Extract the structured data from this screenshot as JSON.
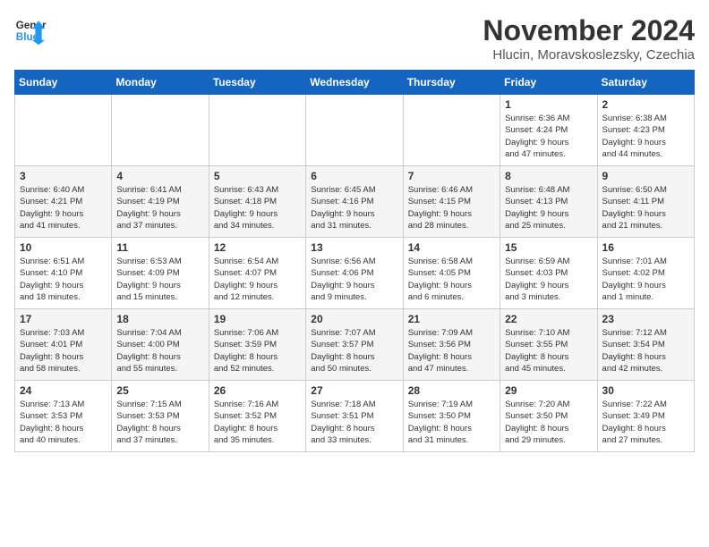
{
  "header": {
    "logo_line1": "General",
    "logo_line2": "Blue",
    "month": "November 2024",
    "location": "Hlucin, Moravskoslezsky, Czechia"
  },
  "weekdays": [
    "Sunday",
    "Monday",
    "Tuesday",
    "Wednesday",
    "Thursday",
    "Friday",
    "Saturday"
  ],
  "weeks": [
    [
      {
        "day": "",
        "info": ""
      },
      {
        "day": "",
        "info": ""
      },
      {
        "day": "",
        "info": ""
      },
      {
        "day": "",
        "info": ""
      },
      {
        "day": "",
        "info": ""
      },
      {
        "day": "1",
        "info": "Sunrise: 6:36 AM\nSunset: 4:24 PM\nDaylight: 9 hours\nand 47 minutes."
      },
      {
        "day": "2",
        "info": "Sunrise: 6:38 AM\nSunset: 4:23 PM\nDaylight: 9 hours\nand 44 minutes."
      }
    ],
    [
      {
        "day": "3",
        "info": "Sunrise: 6:40 AM\nSunset: 4:21 PM\nDaylight: 9 hours\nand 41 minutes."
      },
      {
        "day": "4",
        "info": "Sunrise: 6:41 AM\nSunset: 4:19 PM\nDaylight: 9 hours\nand 37 minutes."
      },
      {
        "day": "5",
        "info": "Sunrise: 6:43 AM\nSunset: 4:18 PM\nDaylight: 9 hours\nand 34 minutes."
      },
      {
        "day": "6",
        "info": "Sunrise: 6:45 AM\nSunset: 4:16 PM\nDaylight: 9 hours\nand 31 minutes."
      },
      {
        "day": "7",
        "info": "Sunrise: 6:46 AM\nSunset: 4:15 PM\nDaylight: 9 hours\nand 28 minutes."
      },
      {
        "day": "8",
        "info": "Sunrise: 6:48 AM\nSunset: 4:13 PM\nDaylight: 9 hours\nand 25 minutes."
      },
      {
        "day": "9",
        "info": "Sunrise: 6:50 AM\nSunset: 4:11 PM\nDaylight: 9 hours\nand 21 minutes."
      }
    ],
    [
      {
        "day": "10",
        "info": "Sunrise: 6:51 AM\nSunset: 4:10 PM\nDaylight: 9 hours\nand 18 minutes."
      },
      {
        "day": "11",
        "info": "Sunrise: 6:53 AM\nSunset: 4:09 PM\nDaylight: 9 hours\nand 15 minutes."
      },
      {
        "day": "12",
        "info": "Sunrise: 6:54 AM\nSunset: 4:07 PM\nDaylight: 9 hours\nand 12 minutes."
      },
      {
        "day": "13",
        "info": "Sunrise: 6:56 AM\nSunset: 4:06 PM\nDaylight: 9 hours\nand 9 minutes."
      },
      {
        "day": "14",
        "info": "Sunrise: 6:58 AM\nSunset: 4:05 PM\nDaylight: 9 hours\nand 6 minutes."
      },
      {
        "day": "15",
        "info": "Sunrise: 6:59 AM\nSunset: 4:03 PM\nDaylight: 9 hours\nand 3 minutes."
      },
      {
        "day": "16",
        "info": "Sunrise: 7:01 AM\nSunset: 4:02 PM\nDaylight: 9 hours\nand 1 minute."
      }
    ],
    [
      {
        "day": "17",
        "info": "Sunrise: 7:03 AM\nSunset: 4:01 PM\nDaylight: 8 hours\nand 58 minutes."
      },
      {
        "day": "18",
        "info": "Sunrise: 7:04 AM\nSunset: 4:00 PM\nDaylight: 8 hours\nand 55 minutes."
      },
      {
        "day": "19",
        "info": "Sunrise: 7:06 AM\nSunset: 3:59 PM\nDaylight: 8 hours\nand 52 minutes."
      },
      {
        "day": "20",
        "info": "Sunrise: 7:07 AM\nSunset: 3:57 PM\nDaylight: 8 hours\nand 50 minutes."
      },
      {
        "day": "21",
        "info": "Sunrise: 7:09 AM\nSunset: 3:56 PM\nDaylight: 8 hours\nand 47 minutes."
      },
      {
        "day": "22",
        "info": "Sunrise: 7:10 AM\nSunset: 3:55 PM\nDaylight: 8 hours\nand 45 minutes."
      },
      {
        "day": "23",
        "info": "Sunrise: 7:12 AM\nSunset: 3:54 PM\nDaylight: 8 hours\nand 42 minutes."
      }
    ],
    [
      {
        "day": "24",
        "info": "Sunrise: 7:13 AM\nSunset: 3:53 PM\nDaylight: 8 hours\nand 40 minutes."
      },
      {
        "day": "25",
        "info": "Sunrise: 7:15 AM\nSunset: 3:53 PM\nDaylight: 8 hours\nand 37 minutes."
      },
      {
        "day": "26",
        "info": "Sunrise: 7:16 AM\nSunset: 3:52 PM\nDaylight: 8 hours\nand 35 minutes."
      },
      {
        "day": "27",
        "info": "Sunrise: 7:18 AM\nSunset: 3:51 PM\nDaylight: 8 hours\nand 33 minutes."
      },
      {
        "day": "28",
        "info": "Sunrise: 7:19 AM\nSunset: 3:50 PM\nDaylight: 8 hours\nand 31 minutes."
      },
      {
        "day": "29",
        "info": "Sunrise: 7:20 AM\nSunset: 3:50 PM\nDaylight: 8 hours\nand 29 minutes."
      },
      {
        "day": "30",
        "info": "Sunrise: 7:22 AM\nSunset: 3:49 PM\nDaylight: 8 hours\nand 27 minutes."
      }
    ]
  ]
}
